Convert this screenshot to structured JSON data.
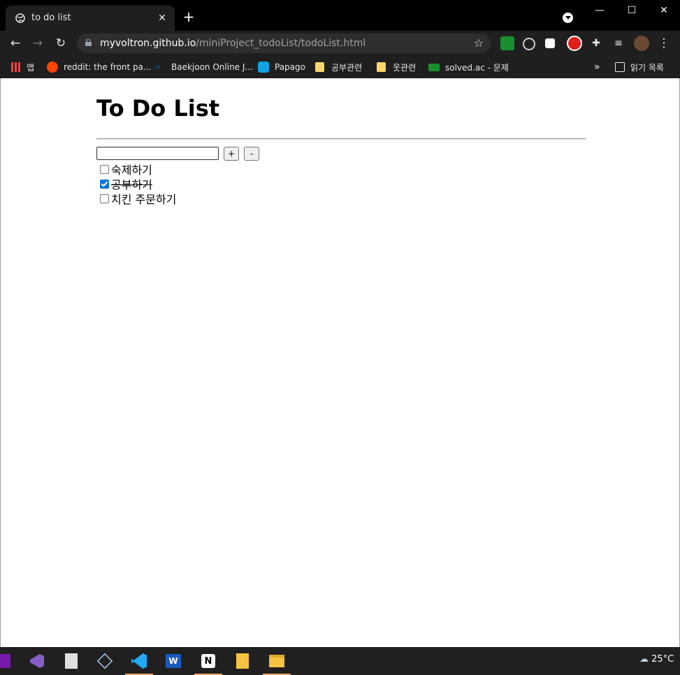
{
  "browser": {
    "tab_title": "to do list",
    "tab_close": "✕",
    "new_tab": "+",
    "url_host": "myvoltron.github.io",
    "url_path": "/miniProject_todoList/todoList.html",
    "window_minimize": "—",
    "window_maximize": "☐",
    "window_close": "✕"
  },
  "bookmarks": {
    "apps": "앱",
    "items": [
      "reddit: the front pa...",
      "Baekjoon Online J...",
      "Papago",
      "공부관련",
      "옷관련",
      "solved.ac - 문제"
    ],
    "more": "»",
    "reading_list": "읽기 목록"
  },
  "page": {
    "heading": "To Do List",
    "add_label": "+",
    "remove_label": "-",
    "input_value": "",
    "todos": [
      {
        "text": "숙제하기",
        "checked": false
      },
      {
        "text": "공부하기",
        "checked": true
      },
      {
        "text": "치킨 주문하기",
        "checked": false
      }
    ]
  },
  "taskbar": {
    "weather": "25°C"
  },
  "colors": {
    "checkbox_checked": "#0b73d9",
    "active_indicator": "#f0a45a"
  }
}
